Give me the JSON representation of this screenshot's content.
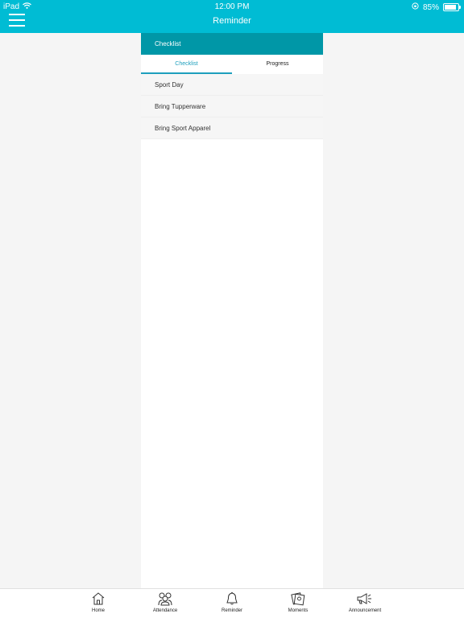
{
  "status_bar": {
    "device": "iPad",
    "time": "12:00 PM",
    "battery": "85%",
    "battery_level": 0.85
  },
  "header": {
    "title": "Reminder"
  },
  "panel": {
    "heading": "Checklist",
    "tabs": [
      {
        "label": "Checklist"
      },
      {
        "label": "Progress"
      }
    ],
    "items": [
      {
        "label": "Sport Day"
      },
      {
        "label": "Bring Tupperware"
      },
      {
        "label": "Bring Sport Apparel"
      }
    ]
  },
  "bottom_nav": [
    {
      "label": "Home",
      "icon": "home-icon"
    },
    {
      "label": "Attendance",
      "icon": "attendance-icon"
    },
    {
      "label": "Reminder",
      "icon": "bell-icon"
    },
    {
      "label": "Moments",
      "icon": "moments-icon"
    },
    {
      "label": "Announcement",
      "icon": "megaphone-icon"
    }
  ],
  "colors": {
    "primary": "#00bcd4",
    "panel_header": "#0097a7",
    "active_tab": "#1e9fbd"
  }
}
